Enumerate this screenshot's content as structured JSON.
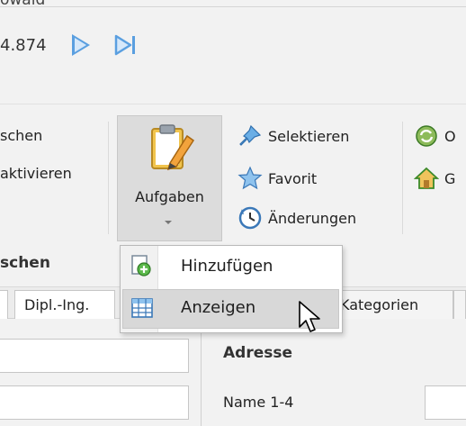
{
  "window": {
    "title_cut": "owald"
  },
  "nav": {
    "value": "4.874"
  },
  "ribbon": {
    "left_items": [
      "schen",
      "aktivieren"
    ],
    "left_group_label": "schen",
    "aufgaben": {
      "label": "Aufgaben"
    },
    "actions": [
      "Selektieren",
      "Favorit",
      "Änderungen"
    ],
    "right_items": [
      "O",
      "G"
    ]
  },
  "menu": {
    "items": [
      {
        "label": "Hinzufügen",
        "icon": "add-icon"
      },
      {
        "label": "Anzeigen",
        "icon": "grid-icon"
      }
    ]
  },
  "form": {
    "title_combo": "Dipl.-Ing.",
    "tab_kategorien": "Kategorien",
    "section_adresse": "Adresse",
    "name_label": "Name 1-4"
  },
  "colors": {
    "accent": "#5a9fe0",
    "menu_hover": "#d8d8d8"
  }
}
